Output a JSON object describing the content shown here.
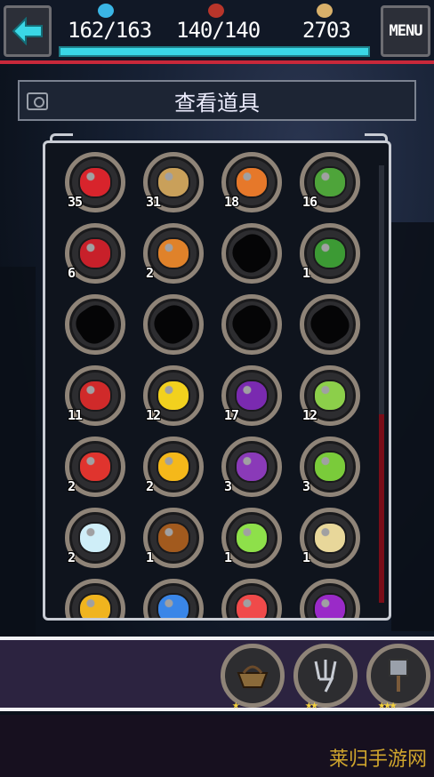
{
  "hud": {
    "hp": "162/163",
    "mp": "140/140",
    "gold": "2703",
    "menu_label": "MENU",
    "hp_fill": 0.99
  },
  "title": "查看道具",
  "slots": [
    {
      "name": "tomato",
      "count": "35",
      "color": "#d8242c",
      "empty": false
    },
    {
      "name": "potato",
      "count": "31",
      "color": "#c9a05a",
      "empty": false
    },
    {
      "name": "carrot",
      "count": "18",
      "color": "#e6782a",
      "empty": false
    },
    {
      "name": "green-pepper",
      "count": "16",
      "color": "#4ea43a",
      "empty": false
    },
    {
      "name": "red-tomato",
      "count": "6",
      "color": "#c8202a",
      "empty": false
    },
    {
      "name": "onion",
      "count": "2",
      "color": "#e0822a",
      "empty": false
    },
    {
      "name": "unknown",
      "count": "",
      "color": "#050506",
      "empty": true
    },
    {
      "name": "broccoli",
      "count": "1",
      "color": "#3c9a34",
      "empty": false
    },
    {
      "name": "unknown",
      "count": "",
      "color": "#050506",
      "empty": true
    },
    {
      "name": "unknown",
      "count": "",
      "color": "#050506",
      "empty": true
    },
    {
      "name": "unknown",
      "count": "",
      "color": "#050506",
      "empty": true
    },
    {
      "name": "unknown",
      "count": "",
      "color": "#050506",
      "empty": true
    },
    {
      "name": "strawberry",
      "count": "11",
      "color": "#d02a2a",
      "empty": false
    },
    {
      "name": "lemon",
      "count": "12",
      "color": "#f2d11e",
      "empty": false
    },
    {
      "name": "cherry",
      "count": "17",
      "color": "#7a2ab0",
      "empty": false
    },
    {
      "name": "pear",
      "count": "12",
      "color": "#8ccf4a",
      "empty": false
    },
    {
      "name": "strawberry-big",
      "count": "2",
      "color": "#e0342e",
      "empty": false
    },
    {
      "name": "orange",
      "count": "2",
      "color": "#f5b81a",
      "empty": false
    },
    {
      "name": "grape",
      "count": "3",
      "color": "#8a3ab8",
      "empty": false
    },
    {
      "name": "green-apple",
      "count": "3",
      "color": "#7acb3a",
      "empty": false
    },
    {
      "name": "ice-apple",
      "count": "2",
      "color": "#cfeef8",
      "empty": false
    },
    {
      "name": "brown-apple",
      "count": "1",
      "color": "#a25a1e",
      "empty": false
    },
    {
      "name": "lime-apple",
      "count": "1",
      "color": "#8ee04a",
      "empty": false
    },
    {
      "name": "cream-apple",
      "count": "1",
      "color": "#e8d79a",
      "empty": false
    },
    {
      "name": "gold-apple",
      "count": "",
      "color": "#f0b41e",
      "empty": false
    },
    {
      "name": "blue-apple",
      "count": "",
      "color": "#3a86e8",
      "empty": false
    },
    {
      "name": "red-apple",
      "count": "",
      "color": "#f04a4a",
      "empty": false
    },
    {
      "name": "purple-apple",
      "count": "",
      "color": "#9a2ac8",
      "empty": false
    }
  ],
  "tools": [
    {
      "name": "basket",
      "stars": "★"
    },
    {
      "name": "fork",
      "stars": "★★"
    },
    {
      "name": "shovel",
      "stars": "★★★"
    }
  ],
  "watermark": "莱归手游网"
}
